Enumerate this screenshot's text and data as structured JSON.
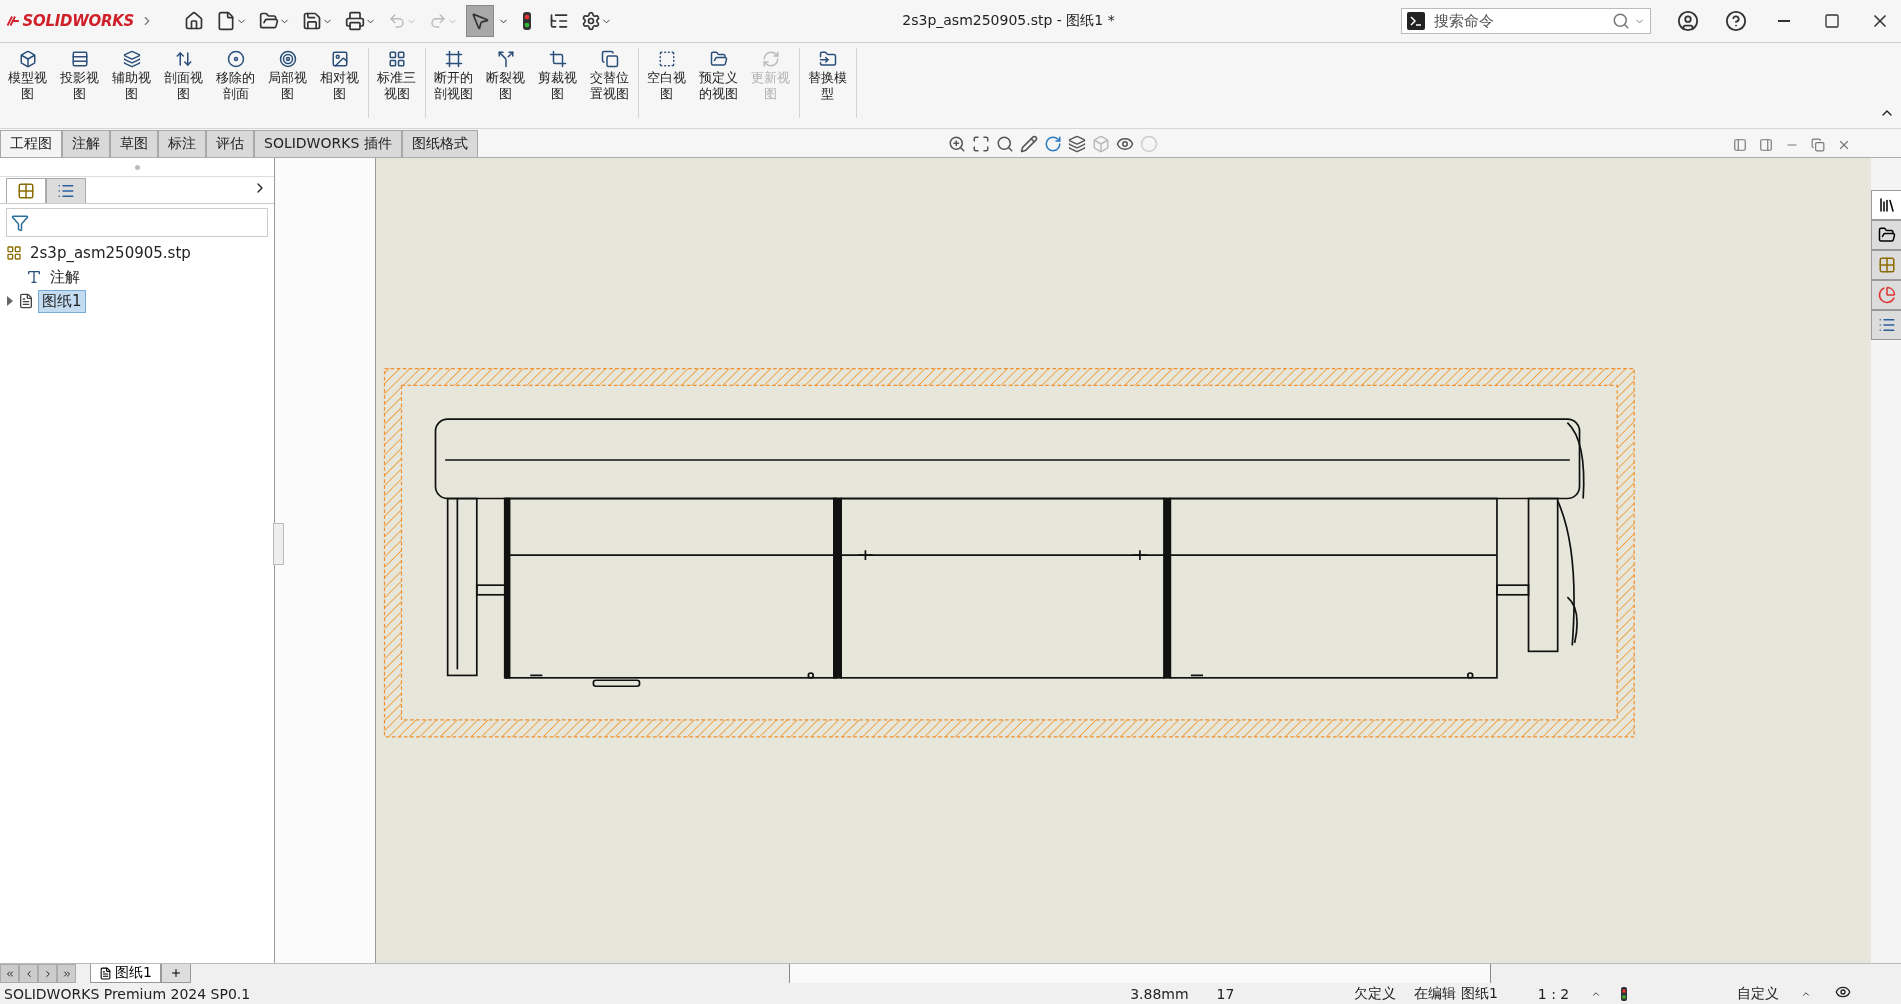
{
  "app": {
    "logo": "SOLIDWORKS",
    "select_tool_active": true
  },
  "window": {
    "title": "2s3p_asm250905.stp - 图纸1 *"
  },
  "search": {
    "placeholder": "搜索命令"
  },
  "ribbon": {
    "groups": [
      {
        "buttons": [
          {
            "label": "模型视图",
            "disabled": false
          },
          {
            "label": "投影视图",
            "disabled": false
          },
          {
            "label": "辅助视图",
            "disabled": false
          },
          {
            "label": "剖面视图",
            "disabled": false
          },
          {
            "label": "移除的剖面",
            "disabled": false
          },
          {
            "label": "局部视图",
            "disabled": false
          },
          {
            "label": "相对视图",
            "disabled": false
          }
        ]
      },
      {
        "buttons": [
          {
            "label": "标准三视图",
            "disabled": false
          }
        ]
      },
      {
        "buttons": [
          {
            "label": "断开的剖视图",
            "disabled": false
          },
          {
            "label": "断裂视图",
            "disabled": false
          },
          {
            "label": "剪裁视图",
            "disabled": false
          },
          {
            "label": "交替位置视图",
            "disabled": false
          }
        ]
      },
      {
        "buttons": [
          {
            "label": "空白视图",
            "disabled": false
          },
          {
            "label": "预定义的视图",
            "disabled": false
          },
          {
            "label": "更新视图",
            "disabled": true
          }
        ]
      },
      {
        "buttons": [
          {
            "label": "替换模型",
            "disabled": false
          }
        ]
      }
    ]
  },
  "tabs": [
    {
      "label": "工程图",
      "selected": true
    },
    {
      "label": "注解",
      "selected": false
    },
    {
      "label": "草图",
      "selected": false
    },
    {
      "label": "标注",
      "selected": false
    },
    {
      "label": "评估",
      "selected": false
    },
    {
      "label": "SOLIDWORKS 插件",
      "selected": false
    },
    {
      "label": "图纸格式",
      "selected": false
    }
  ],
  "panel_tabs": [
    {
      "kind": "feature-tree",
      "selected": true
    },
    {
      "kind": "property",
      "selected": false
    }
  ],
  "tree": {
    "root": "2s3p_asm250905.stp",
    "children": [
      {
        "kind": "annotations",
        "label": "注解",
        "selected": false
      },
      {
        "kind": "sheet",
        "label": "图纸1",
        "selected": true,
        "expanded": false
      }
    ]
  },
  "sheet_tabs": [
    {
      "label": "图纸1",
      "selected": true
    }
  ],
  "status_bar": {
    "product": "SOLIDWORKS Premium 2024 SP0.1",
    "coordinate": "3.88mm",
    "value": "17",
    "definition": "欠定义",
    "mode": "在编辑 图纸1",
    "scale": "1 : 2",
    "units": "自定义"
  }
}
